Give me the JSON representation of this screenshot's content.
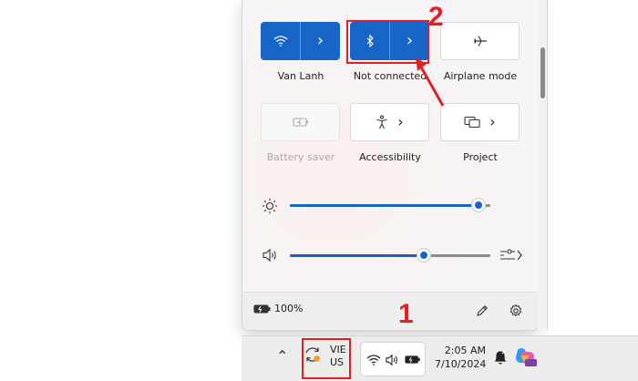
{
  "quick_settings": {
    "tiles": [
      {
        "label": "Van Lanh",
        "icon": "wifi-icon",
        "state": "on"
      },
      {
        "label": "Not connected",
        "icon": "bluetooth-icon",
        "state": "on"
      },
      {
        "label": "Airplane mode",
        "icon": "airplane-icon",
        "state": "off"
      },
      {
        "label": "Battery saver",
        "icon": "battery-saver-icon",
        "state": "disabled"
      },
      {
        "label": "Accessibility",
        "icon": "accessibility-icon",
        "state": "off"
      },
      {
        "label": "Project",
        "icon": "project-icon",
        "state": "off"
      }
    ],
    "brightness": {
      "icon": "brightness-icon",
      "level": 0.94
    },
    "volume": {
      "icon": "speaker-icon",
      "level": 0.67
    },
    "footer": {
      "battery": "100%",
      "edit_icon": "pencil-icon",
      "settings_icon": "gear-icon"
    }
  },
  "annotations": {
    "step1": "1",
    "step2": "2",
    "color": "#e01f26"
  },
  "taskbar": {
    "language_top": "VIE",
    "language_bottom": "US",
    "time": "2:05 AM",
    "date": "7/10/2024"
  },
  "colors": {
    "accent": "#1665c7",
    "annotation": "#e01f26"
  }
}
